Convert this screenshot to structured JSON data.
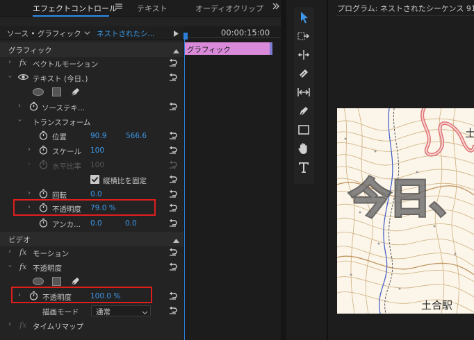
{
  "effect_controls": {
    "tabs": [
      {
        "label": "エフェクトコントロール",
        "active": true
      },
      {
        "label": "テキスト",
        "active": false
      },
      {
        "label": "オーディオクリップ",
        "active": false
      }
    ],
    "menu_icon": "hamburger-icon",
    "overflow_icon": "double-chevron-right-icon",
    "source_label": "ソース • グラフィック",
    "sequence_label": "ネストされたシ...",
    "timecode": "00:00:15:00",
    "clip_label": "グラフィック",
    "sections": {
      "graphic": "グラフィック",
      "video": "ビデオ"
    },
    "rows": {
      "vector_motion": "ベクトルモーション",
      "text_layer": "テキスト (今日、)",
      "source_text": "ソーステキ...",
      "transform": "トランスフォーム",
      "position": {
        "label": "位置",
        "x": "90.9",
        "y": "566.6"
      },
      "scale": {
        "label": "スケール",
        "value": "100"
      },
      "scale_width": {
        "label": "水平比率",
        "value": "100"
      },
      "uniform_scale": {
        "label": "縦横比を固定",
        "checked": true
      },
      "rotation": {
        "label": "回転",
        "value": "0.0"
      },
      "opacity_text": {
        "label": "不透明度",
        "value": "79.0 %"
      },
      "anchor": {
        "label": "アンカ...",
        "x": "0.0",
        "y": "0.0"
      },
      "motion": "モーション",
      "opacity_fx": "不透明度",
      "opacity_video": {
        "label": "不透明度",
        "value": "100.0 %"
      },
      "blend_mode": {
        "label": "描画モード",
        "value": "通常"
      },
      "time_remap": "タイムリマップ"
    }
  },
  "program_monitor": {
    "title": "プログラム: ネストされたシーケンス 91",
    "overlay_text": "今日、",
    "station_label": "土合駅",
    "corner_text": "土"
  },
  "colors": {
    "accent": "#2d8ceb",
    "value_blue": "#3d98e8",
    "clip": "#d98ad9",
    "highlight_box": "#e01e1e"
  }
}
